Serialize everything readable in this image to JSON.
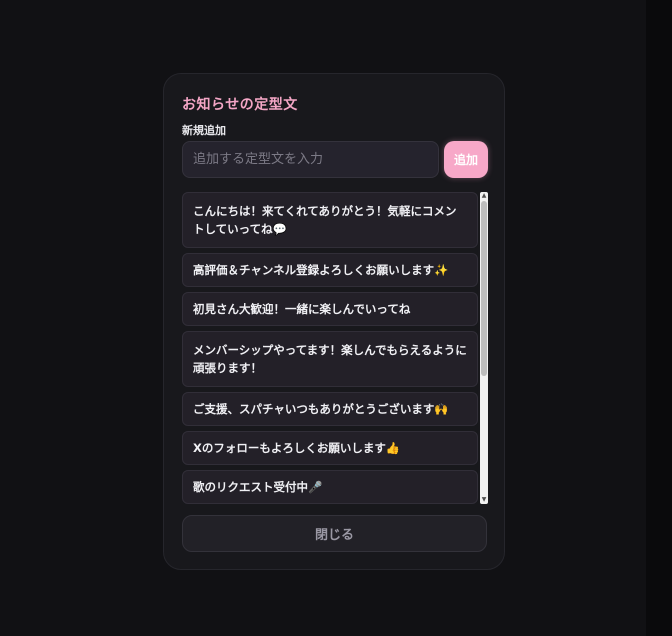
{
  "dialog": {
    "title": "お知らせの定型文",
    "new_label": "新規追加",
    "input_placeholder": "追加する定型文を入力",
    "input_value": "",
    "add_button": "追加",
    "close_button": "閉じる"
  },
  "templates": [
    {
      "text": "こんにちは！来てくれてありがとう！気軽にコメントしていってね",
      "emoji": "💬"
    },
    {
      "text": "高評価＆チャンネル登録よろしくお願いします",
      "emoji": "✨"
    },
    {
      "text": "初見さん大歓迎！一緒に楽しんでいってね",
      "emoji": ""
    },
    {
      "text": "メンバーシップやってます！楽しんでもらえるように頑張ります！",
      "emoji": ""
    },
    {
      "text": "ご支援、スパチャいつもありがとうございます",
      "emoji": "🙌"
    },
    {
      "text": "Xのフォローもよろしくお願いします",
      "emoji": "👍"
    },
    {
      "text": "歌のリクエスト受付中",
      "emoji": "🎤"
    },
    {
      "text": "",
      "emoji": ""
    }
  ],
  "icons": {
    "scroll_up": "scroll-up-arrow",
    "scroll_down": "scroll-down-arrow"
  },
  "colors": {
    "accent": "#f7a8c8",
    "panel_bg": "#18181c",
    "page_bg": "#111114"
  }
}
